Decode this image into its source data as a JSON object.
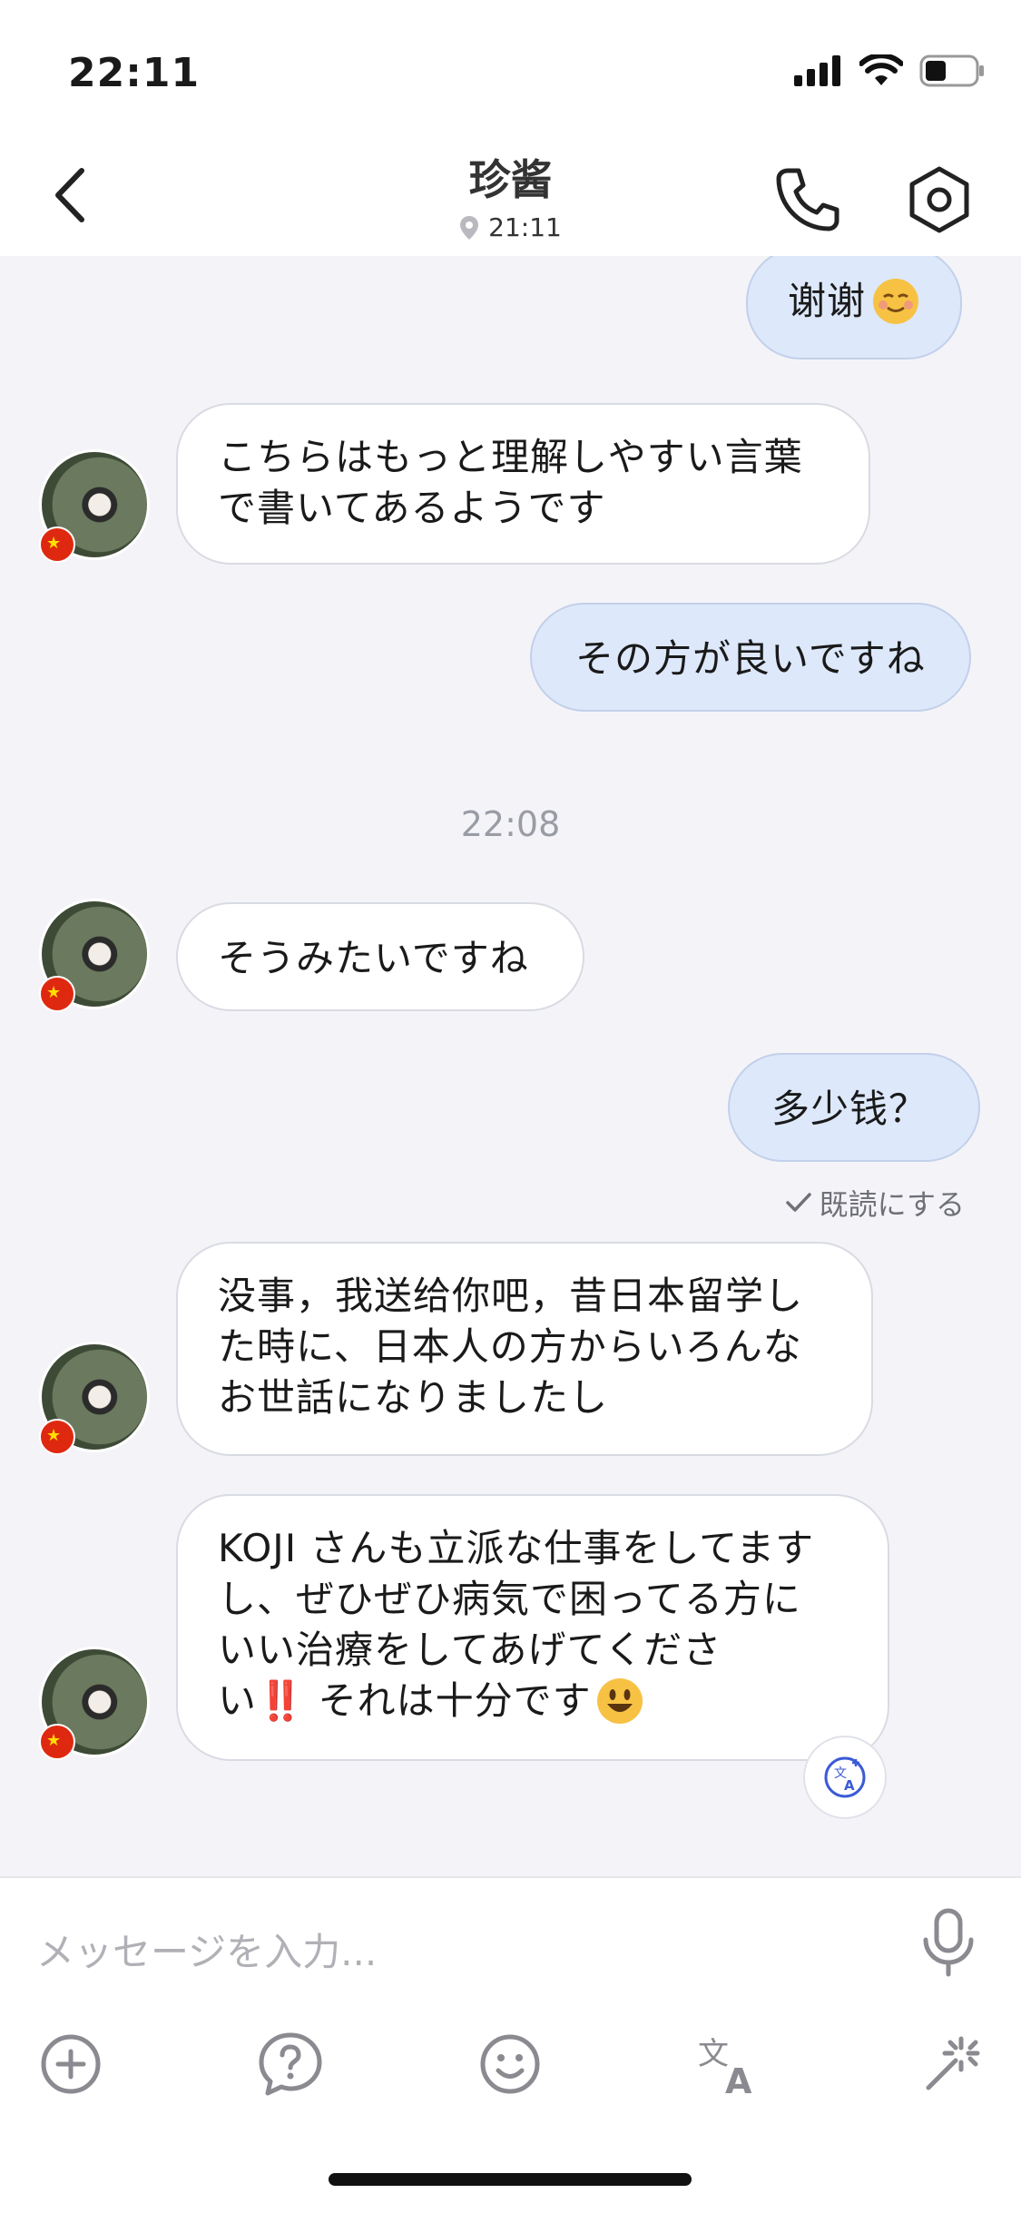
{
  "status_bar": {
    "time": "22:11"
  },
  "header": {
    "title": "珍酱",
    "location_time": "21:11",
    "back_icon": "chevron-left-icon",
    "call_icon": "phone-icon",
    "settings_icon": "settings-hexagon-icon"
  },
  "messages": [
    {
      "direction": "out",
      "text": "谢谢",
      "emoji": "relieved"
    },
    {
      "direction": "in",
      "lines": [
        "こちらはもっと理解しやすい言葉",
        "で書いてあるようです"
      ]
    },
    {
      "direction": "out",
      "text": "その方が良いですね"
    },
    {
      "type": "time",
      "text": "22:08"
    },
    {
      "direction": "in",
      "text": "そうみたいですね"
    },
    {
      "direction": "out",
      "text": "多少钱？",
      "read_receipt": "既読にする"
    },
    {
      "direction": "in",
      "lines": [
        "没事，我送给你吧，昔日本留学し",
        "た時に、日本人の方からいろんな",
        "お世話になりましたし"
      ]
    },
    {
      "direction": "in",
      "lines": [
        "KOJI さんも立派な仕事をしてます",
        "し、ぜひぜひ病気で困ってる方に",
        "いい治療をしてあげてくださ",
        "い‼️ それは十分です"
      ],
      "emoji": "smiley"
    }
  ],
  "composer": {
    "placeholder": "メッセージを入力...",
    "mic_icon": "microphone-icon",
    "tools": [
      "plus-circle-icon",
      "question-bubble-icon",
      "smiley-icon",
      "translate-icon",
      "magic-wand-icon"
    ]
  },
  "colors": {
    "incoming_bubble": "#ffffff",
    "outgoing_bubble": "#dde8fb",
    "background": "#f4f4f8",
    "flag": "#de2910"
  }
}
